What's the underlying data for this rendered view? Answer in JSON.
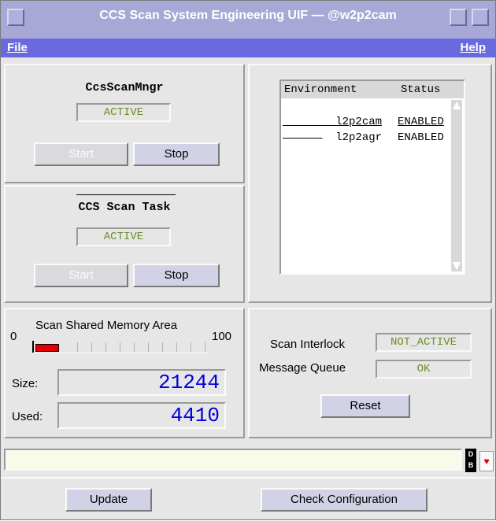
{
  "window": {
    "title": "CCS Scan System Engineering UIF — @w2p2cam"
  },
  "menu": {
    "file": "File",
    "help": "Help"
  },
  "scan_mngr": {
    "title": "CcsScanMngr",
    "status": "ACTIVE",
    "start": "Start",
    "stop": "Stop"
  },
  "scan_task": {
    "title": "CCS Scan Task",
    "status": "ACTIVE",
    "start": "Start",
    "stop": "Stop"
  },
  "environment": {
    "headers": {
      "environment": "Environment",
      "status": "Status"
    },
    "rows": [
      {
        "name": "l2p2cam",
        "status": "ENABLED"
      },
      {
        "name": "l2p2agr",
        "status": "ENABLED"
      }
    ]
  },
  "memory": {
    "title": "Scan Shared Memory Area",
    "min": "0",
    "max": "100",
    "level_percent": 18,
    "size_label": "Size:",
    "size": "21244",
    "used_label": "Used:",
    "used": "4410"
  },
  "interlock": {
    "label": "Scan Interlock",
    "value": "NOT_ACTIVE",
    "queue_label": "Message Queue",
    "queue_value": "OK",
    "reset": "Reset"
  },
  "bottom": {
    "db_icon_text": "D B",
    "update": "Update",
    "check": "Check Configuration"
  },
  "colors": {
    "title_bar": "#a8a8d6",
    "menu_bar": "#6a6ae0",
    "status_green": "#6b8e23",
    "number_blue": "#0000e0",
    "gauge_red": "#e00000"
  }
}
